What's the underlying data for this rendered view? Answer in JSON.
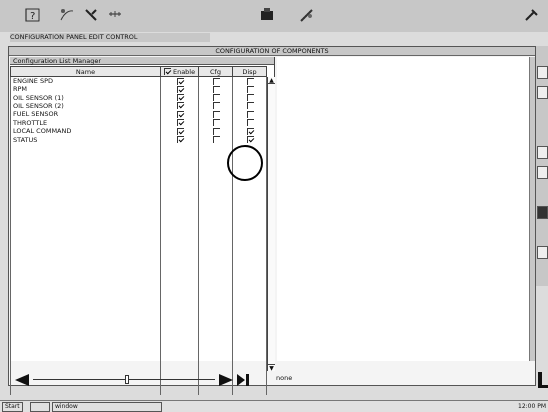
{
  "title_strip": "CONFIGURATION PANEL EDIT CONTROL",
  "window": {
    "title": "CONFIGURATION OF COMPONENTS"
  },
  "left_pane": {
    "header": "Configuration List Manager",
    "columns": [
      "Name",
      "Enable",
      "Cfg",
      "Disp"
    ],
    "rows": [
      {
        "name": "ENGINE SPD",
        "c1": true,
        "c2": false,
        "c3": false
      },
      {
        "name": "RPM",
        "c1": true,
        "c2": false,
        "c3": false
      },
      {
        "name": "OIL SENSOR (1)",
        "c1": true,
        "c2": false,
        "c3": false
      },
      {
        "name": "OIL SENSOR (2)",
        "c1": true,
        "c2": false,
        "c3": false
      },
      {
        "name": "FUEL SENSOR",
        "c1": true,
        "c2": false,
        "c3": false
      },
      {
        "name": "THROTTLE",
        "c1": true,
        "c2": false,
        "c3": false
      },
      {
        "name": "LOCAL COMMAND",
        "c1": true,
        "c2": false,
        "c3": true
      },
      {
        "name": "STATUS",
        "c1": true,
        "c2": false,
        "c3": true
      }
    ]
  },
  "scroll_label": "none",
  "taskbar": {
    "start": "Start",
    "items": [
      "",
      "window"
    ],
    "tray": "12:00 PM"
  },
  "icons": {
    "toolbar": [
      "help-icon",
      "paint-icon",
      "tools-icon",
      "ruler-icon",
      "document-icon",
      "brush-icon",
      "corner-icon"
    ]
  }
}
